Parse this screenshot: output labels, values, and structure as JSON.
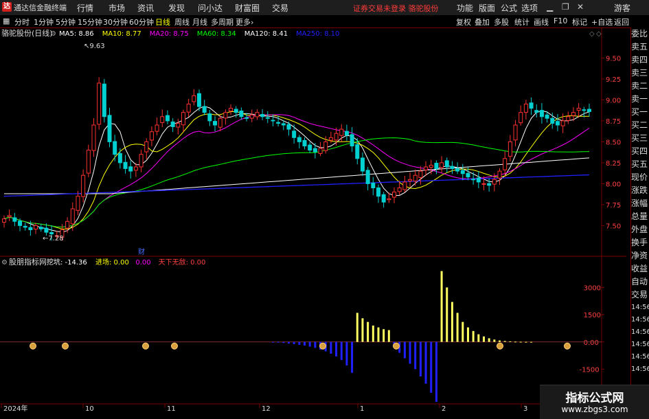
{
  "app": {
    "title": "通达信金融终端",
    "login_status": "证券交易未登录",
    "broker": "骆驼股份"
  },
  "menu": [
    "行情",
    "市场",
    "资讯",
    "发现",
    "问小达",
    "财富圈",
    "交易"
  ],
  "right_menu": [
    "功能",
    "版面",
    "公式",
    "选项"
  ],
  "guest": "游客",
  "periods": [
    "分时",
    "1分钟",
    "5分钟",
    "15分钟",
    "30分钟",
    "60分钟",
    "日线",
    "周线",
    "月线",
    "多周期",
    "更多"
  ],
  "active_period": "日线",
  "right_tools": [
    "复权",
    "叠加",
    "多股",
    "统计",
    "画线",
    "F10",
    "标记",
    "+自选",
    "返回"
  ],
  "main_chart": {
    "stock_label": "骆驼股份(日线)",
    "ma": [
      {
        "name": "MA5",
        "value": "8.86",
        "color": "#ffffff"
      },
      {
        "name": "MA10",
        "value": "8.77",
        "color": "#ffff00"
      },
      {
        "name": "MA20",
        "value": "8.75",
        "color": "#ff00ff"
      },
      {
        "name": "MA60",
        "value": "8.34",
        "color": "#00ff00"
      },
      {
        "name": "MA120",
        "value": "8.41",
        "color": "#ffffff"
      },
      {
        "name": "MA250",
        "value": "8.10",
        "color": "#2020ff"
      }
    ],
    "high_label": "9.63",
    "low_label": "7.28",
    "event_label": "财"
  },
  "sub_chart": {
    "indicator": "股朋指标网",
    "fields": [
      {
        "name": "挖坑",
        "value": "-14.36",
        "color": "#ffffff"
      },
      {
        "name": "进场",
        "value": "0.00",
        "color": "#ffff00"
      },
      {
        "name": "",
        "value": "0.00",
        "color": "#ff00ff"
      },
      {
        "name": "天下无敌",
        "value": "0.00",
        "color": "#ff4040"
      }
    ]
  },
  "x_labels": [
    "2024年",
    "10",
    "11",
    "12",
    "1",
    "2",
    "3"
  ],
  "side_labels": [
    "委比",
    "卖五",
    "卖四",
    "卖三",
    "卖二",
    "卖一",
    "买一",
    "买二",
    "买三",
    "买四",
    "买五",
    "现价",
    "涨跌",
    "涨幅",
    "总量",
    "外盘",
    "换手",
    "净资",
    "收益",
    "自动",
    "交易"
  ],
  "side_sub_labels": [
    "14:56",
    "14:56",
    "14:56",
    "14:56",
    "14:56",
    "14:56"
  ],
  "watermark": {
    "title": "指标公式网",
    "url": "www.zbgs3.com"
  },
  "chart_data": [
    {
      "type": "candlestick",
      "title": "骆驼股份(日线)",
      "ylim": [
        7.2,
        9.7
      ],
      "y_ticks": [
        "9.50",
        "9.25",
        "9.00",
        "8.75",
        "8.50",
        "8.25",
        "8.00",
        "7.75",
        "7.50"
      ],
      "closes": [
        7.58,
        7.62,
        7.55,
        7.5,
        7.48,
        7.45,
        7.5,
        7.46,
        7.42,
        7.4,
        7.38,
        7.45,
        7.55,
        7.7,
        7.85,
        8.1,
        8.4,
        8.7,
        9.2,
        8.8,
        8.5,
        8.35,
        8.25,
        8.18,
        8.15,
        8.2,
        8.35,
        8.5,
        8.62,
        8.7,
        8.8,
        8.75,
        8.68,
        8.72,
        8.85,
        8.95,
        9.05,
        8.92,
        8.85,
        8.75,
        8.7,
        8.78,
        8.85,
        8.9,
        8.85,
        8.8,
        8.78,
        8.82,
        8.85,
        8.8,
        8.78,
        8.75,
        8.72,
        8.7,
        8.65,
        8.55,
        8.5,
        8.45,
        8.4,
        8.38,
        8.42,
        8.5,
        8.55,
        8.6,
        8.65,
        8.58,
        8.45,
        8.3,
        8.15,
        8.0,
        7.95,
        7.85,
        7.78,
        7.82,
        7.9,
        7.95,
        8.02,
        8.05,
        8.1,
        8.15,
        8.2,
        8.22,
        8.18,
        8.25,
        8.2,
        8.18,
        8.15,
        8.12,
        8.08,
        8.05,
        8.02,
        8.0,
        7.98,
        8.05,
        8.15,
        8.3,
        8.5,
        8.7,
        8.85,
        8.95,
        8.9,
        8.85,
        8.8,
        8.78,
        8.72,
        8.7,
        8.75,
        8.8,
        8.85,
        8.9,
        8.88,
        8.86
      ]
    },
    {
      "type": "bar",
      "title": "股朋指标网",
      "ylim": [
        -3300,
        4000
      ],
      "y_ticks": [
        "3000",
        "1500",
        "0.00",
        "-1500",
        "-3000"
      ],
      "values": [
        0,
        0,
        0,
        0,
        0,
        0,
        0,
        0,
        0,
        0,
        0,
        0,
        0,
        0,
        0,
        0,
        0,
        0,
        0,
        0,
        0,
        0,
        0,
        0,
        0,
        0,
        0,
        0,
        0,
        0,
        0,
        0,
        0,
        0,
        0,
        0,
        0,
        0,
        0,
        0,
        0,
        0,
        0,
        0,
        0,
        0,
        0,
        0,
        0,
        0,
        0,
        -20,
        -40,
        -60,
        -90,
        -120,
        -160,
        -200,
        -260,
        -330,
        -420,
        -520,
        -650,
        -800,
        -1000,
        -1300,
        -1700,
        1600,
        1300,
        1100,
        900,
        800,
        700,
        650,
        -300,
        -600,
        -900,
        -1200,
        -1500,
        -1900,
        -2300,
        -2800,
        -3300,
        3900,
        3000,
        2200,
        1600,
        1100,
        800,
        600,
        420,
        300,
        200,
        130,
        80,
        50,
        30,
        15,
        8,
        4,
        2,
        0,
        0,
        0,
        0,
        0,
        0,
        0,
        0,
        0,
        0,
        0,
        0,
        0
      ]
    }
  ]
}
